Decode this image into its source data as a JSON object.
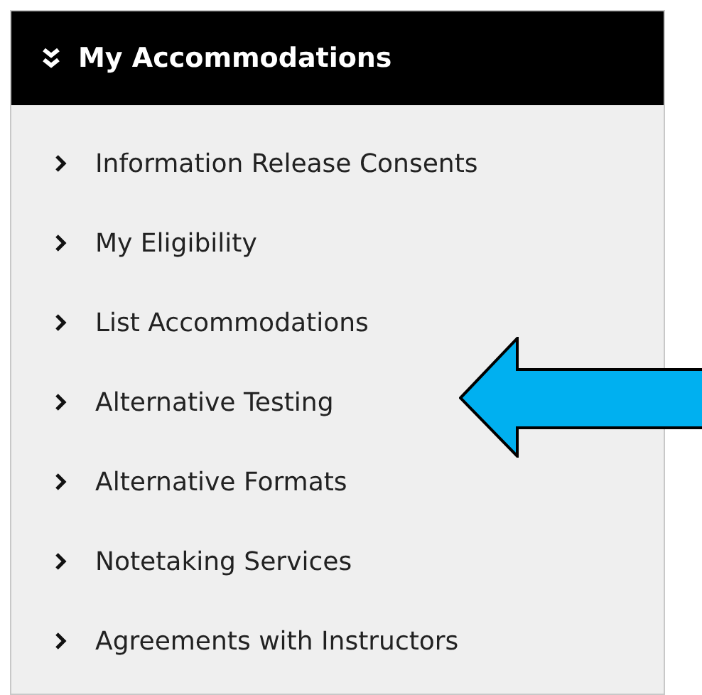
{
  "panel": {
    "title": "My Accommodations",
    "items": [
      {
        "label": "Information Release Consents"
      },
      {
        "label": "My Eligibility"
      },
      {
        "label": "List Accommodations"
      },
      {
        "label": "Alternative Testing"
      },
      {
        "label": "Alternative Formats"
      },
      {
        "label": "Notetaking Services"
      },
      {
        "label": "Agreements with Instructors"
      }
    ]
  }
}
